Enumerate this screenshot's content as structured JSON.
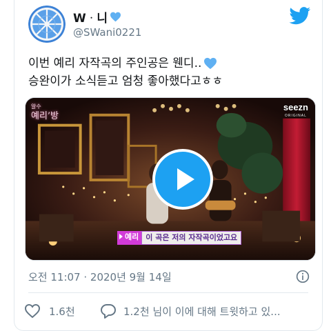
{
  "user": {
    "display_name": "Wᆞ니",
    "handle": "@SWani0221",
    "avatar_icon": "orange-slice-avatar",
    "badge_icon": "blue-heart-emoji"
  },
  "brand": {
    "icon": "twitter-bird-icon",
    "color": "#1da1f2"
  },
  "tweet": {
    "lines": [
      "이번 예리 자작곡의 주인공은 웬디..",
      "승완이가 소식듣고 엄청 좋아했다고ㅎㅎ"
    ],
    "line1_emoji": "blue-heart-emoji"
  },
  "media": {
    "type": "video",
    "play_icon": "play-icon",
    "show_logo": "예리’방",
    "show_logo_sub": "알수",
    "network": "seezn",
    "network_sub": "ORIGINAL",
    "subtitle_speaker": "예리",
    "subtitle_text": "이 곡은 저의 자작곡이었고요"
  },
  "meta": {
    "timestamp": "오전 11:07 · 2020년 9월 14일",
    "info_icon": "info-icon"
  },
  "actions": {
    "like_count": "1.6천",
    "reply_text": "1.2천 님이 이에 대해 트윗하고 있..."
  },
  "colors": {
    "text_primary": "#14171a",
    "text_secondary": "#657786",
    "accent": "#1da1f2",
    "heart": "#5fb0f2"
  }
}
